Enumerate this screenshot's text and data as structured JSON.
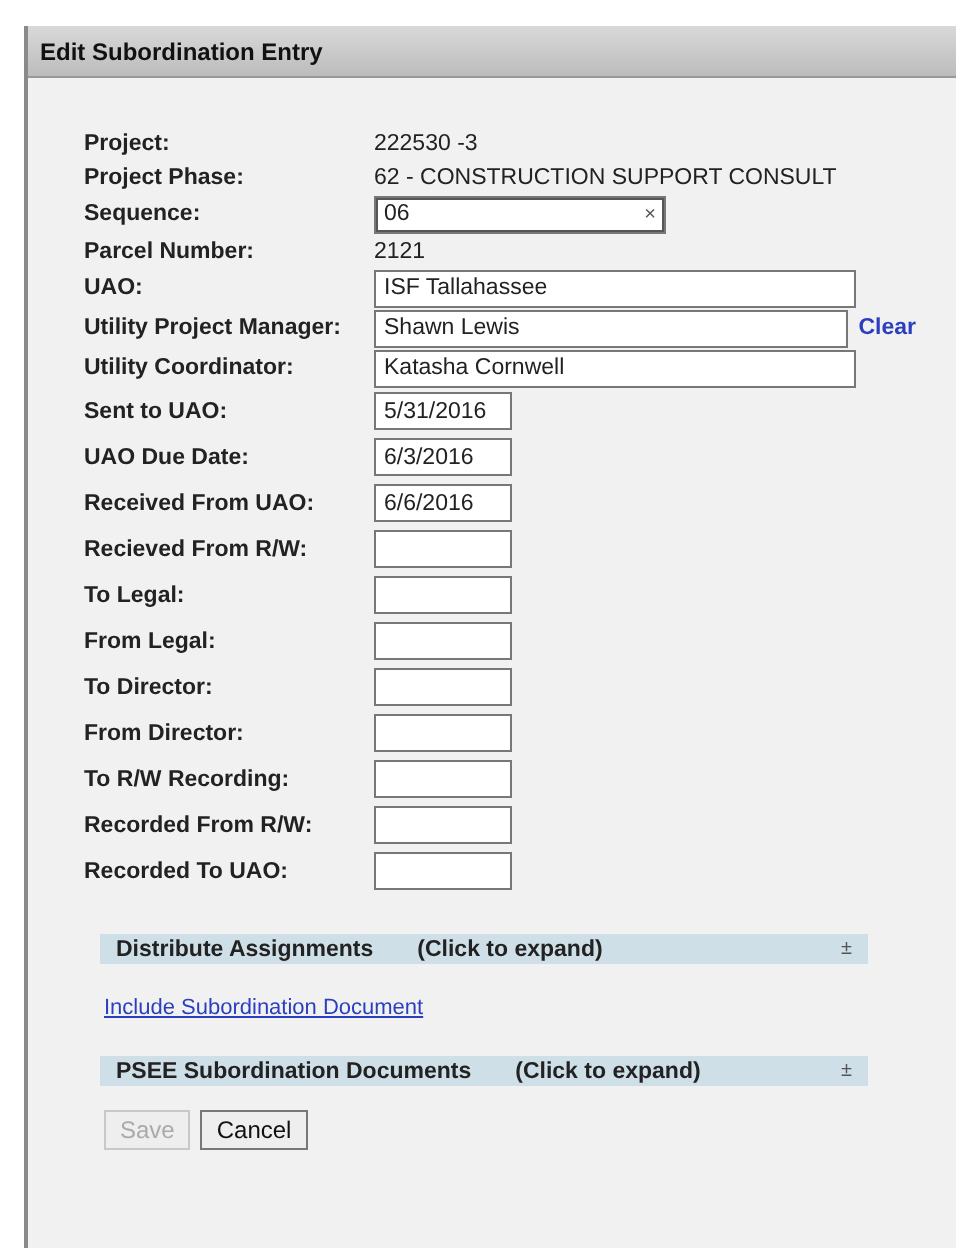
{
  "window": {
    "title": "Edit Subordination Entry"
  },
  "fields": [
    {
      "label": "Project:",
      "kind": "text",
      "value": "222530 -3"
    },
    {
      "label": "Project Phase:",
      "kind": "text",
      "value": "62 - CONSTRUCTION SUPPORT CONSULT"
    },
    {
      "label": "Sequence:",
      "kind": "combo",
      "value": "06",
      "clear_glyph": "×"
    },
    {
      "label": "Parcel Number:",
      "kind": "text",
      "value": "2121"
    },
    {
      "label": "UAO:",
      "kind": "wide",
      "value": "ISF Tallahassee"
    },
    {
      "label": "Utility Project Manager:",
      "kind": "wide",
      "value": "Shawn Lewis",
      "link": "Clear"
    },
    {
      "label": "Utility Coordinator:",
      "kind": "wide",
      "value": "Katasha Cornwell"
    },
    {
      "label": "Sent to UAO:",
      "kind": "date",
      "value": "5/31/2016"
    },
    {
      "label": "UAO Due Date:",
      "kind": "date",
      "value": "6/3/2016"
    },
    {
      "label": "Received From UAO:",
      "kind": "date",
      "value": "6/6/2016"
    },
    {
      "label": "Recieved From R/W:",
      "kind": "date"
    },
    {
      "label": "To Legal:",
      "kind": "date"
    },
    {
      "label": "From Legal:",
      "kind": "date"
    },
    {
      "label": "To Director:",
      "kind": "date"
    },
    {
      "label": "From Director:",
      "kind": "date"
    },
    {
      "label": "To R/W Recording:",
      "kind": "date"
    },
    {
      "label": "Recorded From R/W:",
      "kind": "date"
    },
    {
      "label": "Recorded To UAO:",
      "kind": "date"
    }
  ],
  "sections": [
    {
      "title": "Distribute Assignments",
      "hint": "(Click to expand)",
      "glyph": "±",
      "expanded": false
    },
    {
      "link": "Include Subordination Document"
    },
    {
      "title": "PSEE Subordination Documents",
      "hint": "(Click to expand)",
      "glyph": "±",
      "expanded": false
    }
  ],
  "buttons": [
    {
      "label": "Save",
      "disabled": true
    },
    {
      "label": "Cancel",
      "disabled": false
    }
  ]
}
